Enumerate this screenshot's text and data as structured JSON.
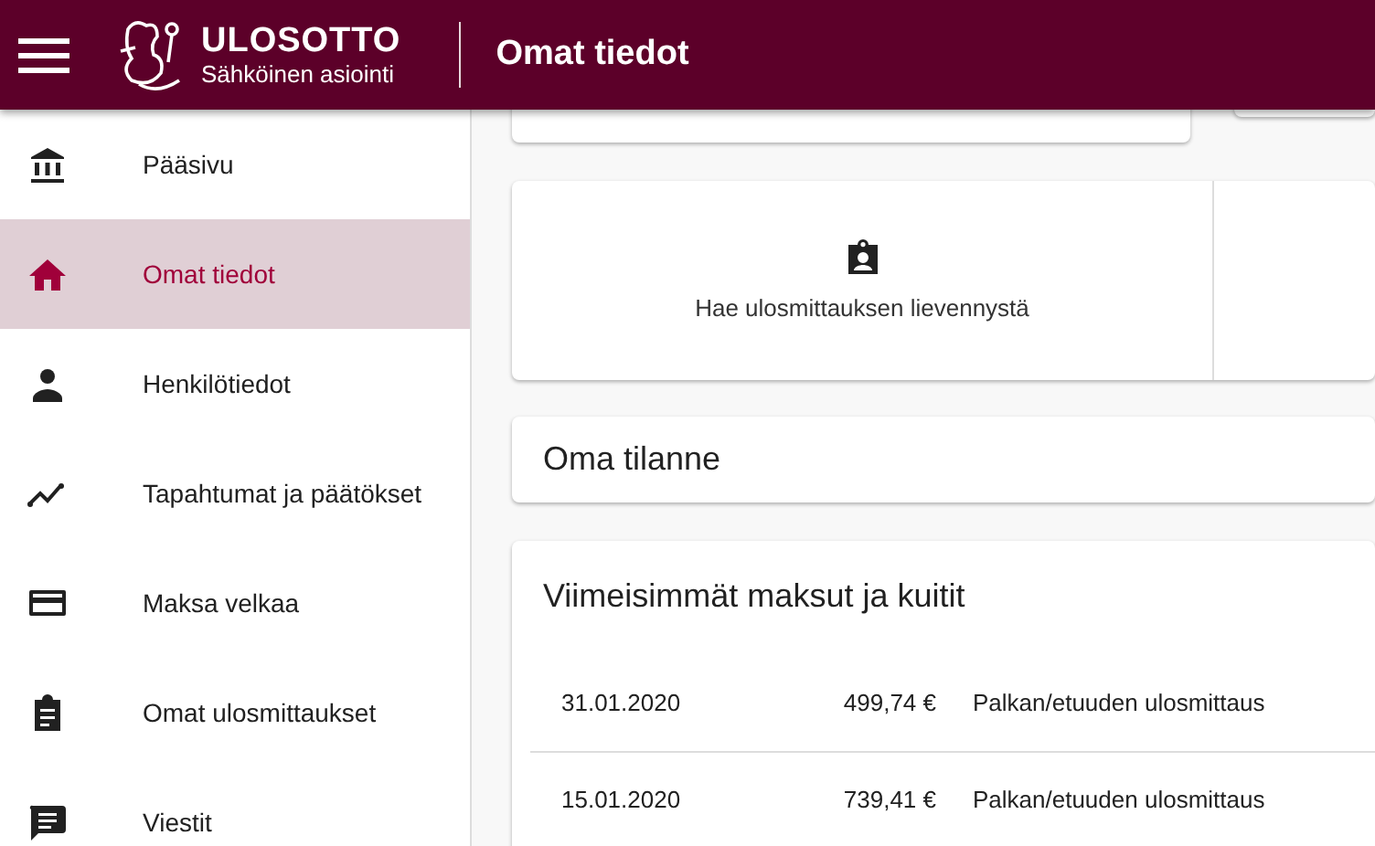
{
  "header": {
    "brand": "ULOSOTTO",
    "subtitle": "Sähköinen asiointi",
    "page_title": "Omat tiedot"
  },
  "sidebar": {
    "items": [
      {
        "label": "Pääsivu",
        "selected": false
      },
      {
        "label": "Omat tiedot",
        "selected": true
      },
      {
        "label": "Henkilötiedot",
        "selected": false
      },
      {
        "label": "Tapahtumat ja päätökset",
        "selected": false
      },
      {
        "label": "Maksa velkaa",
        "selected": false
      },
      {
        "label": "Omat ulosmittaukset",
        "selected": false
      },
      {
        "label": "Viestit",
        "selected": false
      }
    ]
  },
  "actions": [
    {
      "label": "Hae ulosmittauksen lievennystä"
    }
  ],
  "situation": {
    "title": "Oma tilanne"
  },
  "payments": {
    "title": "Viimeisimmät maksut ja kuitit",
    "rows": [
      {
        "date": "31.01.2020",
        "amount": "499,74 €",
        "description": "Palkan/etuuden ulosmittaus"
      },
      {
        "date": "15.01.2020",
        "amount": "739,41 €",
        "description": "Palkan/etuuden ulosmittaus"
      }
    ]
  }
}
